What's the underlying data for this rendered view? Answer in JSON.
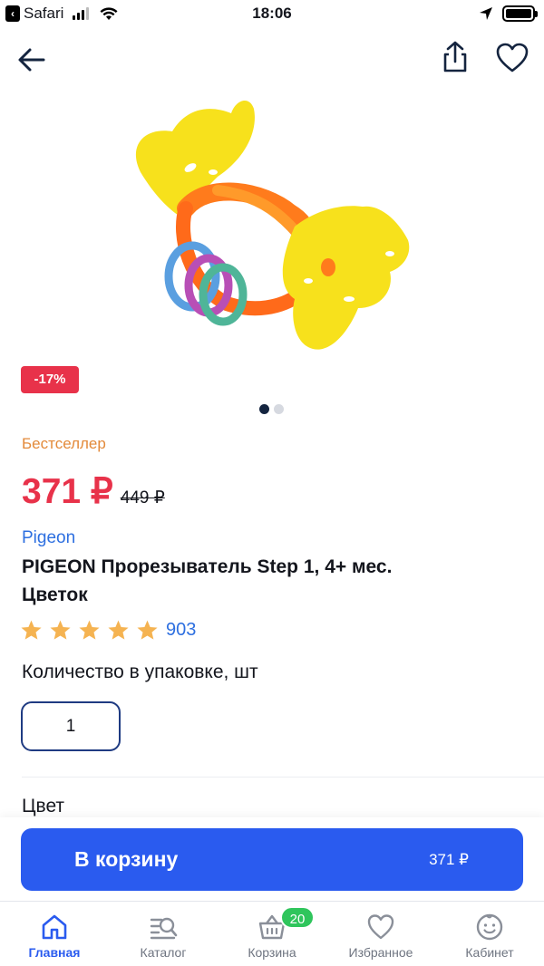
{
  "status_bar": {
    "back_app": "Safari",
    "time": "18:06"
  },
  "product": {
    "discount": "-17%",
    "bestseller": "Бестселлер",
    "price": "371 ₽",
    "old_price": "449 ₽",
    "brand": "Pigeon",
    "title": "PIGEON Прорезыватель Step 1, 4+ мес. Цветок",
    "rating_stars": 5,
    "rating_count": "903",
    "image_count": 2,
    "active_image": 1
  },
  "quantity": {
    "label": "Количество в упаковке, шт",
    "value": "1"
  },
  "color": {
    "label": "Цвет"
  },
  "cart_button": {
    "label": "В корзину",
    "amount": "371 ₽"
  },
  "tabbar": {
    "items": [
      {
        "label": "Главная",
        "icon": "home-icon",
        "active": true
      },
      {
        "label": "Каталог",
        "icon": "catalog-search-icon",
        "active": false
      },
      {
        "label": "Корзина",
        "icon": "basket-icon",
        "active": false
      },
      {
        "label": "Избранное",
        "icon": "heart-icon",
        "active": false
      },
      {
        "label": "Кабинет",
        "icon": "smiley-face-icon",
        "active": false
      }
    ],
    "cart_badge": "20"
  },
  "colors": {
    "accent": "#2a5bef",
    "price": "#e8324a",
    "badge_green": "#2fc55c",
    "bestseller": "#e38a3a",
    "star": "#f5b351"
  }
}
